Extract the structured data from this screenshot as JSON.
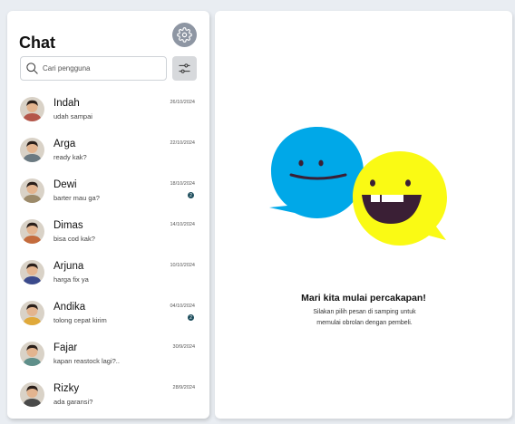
{
  "sidebar": {
    "title": "Chat",
    "search": {
      "placeholder": "Cari pengguna"
    },
    "chats": [
      {
        "name": "Indah",
        "message": "udah sampai",
        "date": "26/10/2024",
        "unread": "",
        "avatar_color": "#b4564a"
      },
      {
        "name": "Arga",
        "message": "ready kak?",
        "date": "22/10/2024",
        "unread": "",
        "avatar_color": "#6b7a82"
      },
      {
        "name": "Dewi",
        "message": "barter mau ga?",
        "date": "18/10/2024",
        "unread": "2",
        "avatar_color": "#9c8a6a"
      },
      {
        "name": "Dimas",
        "message": "bisa cod kak?",
        "date": "14/10/2024",
        "unread": "",
        "avatar_color": "#c46b3c"
      },
      {
        "name": "Arjuna",
        "message": "harga fix ya",
        "date": "10/10/2024",
        "unread": "",
        "avatar_color": "#3b4a8c"
      },
      {
        "name": "Andika",
        "message": "tolong cepat kirim",
        "date": "04/10/2024",
        "unread": "2",
        "avatar_color": "#e0a93a"
      },
      {
        "name": "Fajar",
        "message": "kapan reastock lagi?..",
        "date": "30/9/2024",
        "unread": "",
        "avatar_color": "#5f8f8a"
      },
      {
        "name": "Rizky",
        "message": "ada garansi?",
        "date": "28/9/2024",
        "unread": "",
        "avatar_color": "#4a4a4a"
      }
    ]
  },
  "main": {
    "empty_title": "Mari kita mulai percakapan!",
    "empty_description": "Silakan pilih pesan di samping untuk memulai obrolan dengan pembeli.",
    "bubble_colors": {
      "blue": "#00a8e8",
      "yellow": "#fafa14",
      "face": "#3a1f35"
    }
  }
}
